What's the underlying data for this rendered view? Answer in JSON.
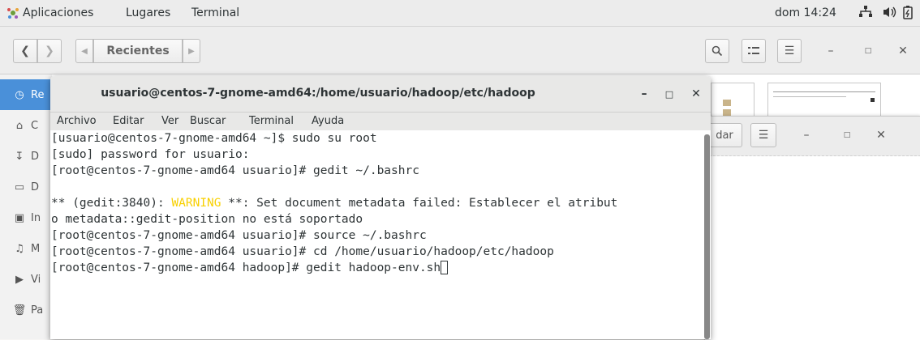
{
  "topbar": {
    "apps_label": "Aplicaciones",
    "places_label": "Lugares",
    "terminal_label": "Terminal",
    "clock": "dom 14:24"
  },
  "nautilus": {
    "location_label": "Recientes",
    "sidebar": [
      {
        "icon": "recent-icon",
        "label": "Re",
        "active": true
      },
      {
        "icon": "home-icon",
        "label": "C"
      },
      {
        "icon": "download-icon",
        "label": "D"
      },
      {
        "icon": "document-icon",
        "label": "D"
      },
      {
        "icon": "image-icon",
        "label": "In"
      },
      {
        "icon": "music-icon",
        "label": "M"
      },
      {
        "icon": "video-icon",
        "label": "Vi"
      },
      {
        "icon": "trash-icon",
        "label": "Pa"
      }
    ]
  },
  "window2": {
    "partial_label": "dar"
  },
  "terminal": {
    "title": "usuario@centos-7-gnome-amd64:/home/usuario/hadoop/etc/hadoop",
    "menu": [
      "Archivo",
      "Editar",
      "Ver",
      "Buscar",
      "Terminal",
      "Ayuda"
    ],
    "lines": [
      "[usuario@centos-7-gnome-amd64 ~]$ sudo su root",
      "[sudo] password for usuario:",
      "[root@centos-7-gnome-amd64 usuario]# gedit ~/.bashrc",
      "",
      "** (gedit:3840): ",
      "WARNING",
      " **: Set document metadata failed: Establecer el atribut",
      "o metadata::gedit-position no está soportado",
      "[root@centos-7-gnome-amd64 usuario]# source ~/.bashrc",
      "[root@centos-7-gnome-amd64 usuario]# cd /home/usuario/hadoop/etc/hadoop",
      "[root@centos-7-gnome-amd64 hadoop]# gedit hadoop-env.sh"
    ]
  },
  "colors": {
    "accent": "#4a90d9",
    "warning": "#f8d000"
  }
}
